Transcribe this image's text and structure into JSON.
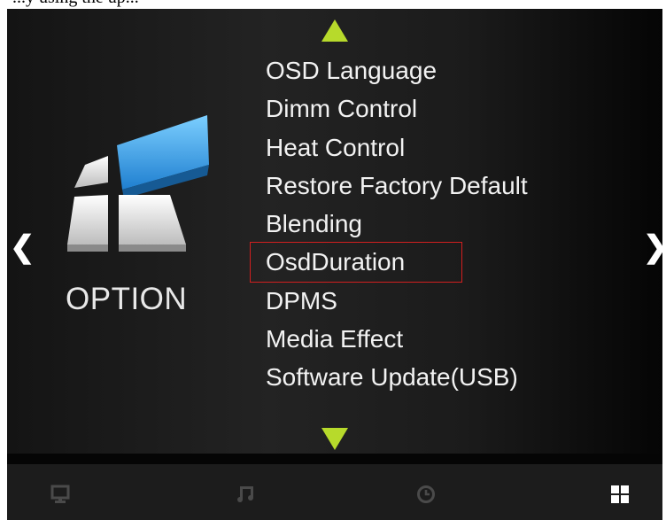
{
  "top_fragment": "...y using the up...",
  "navigation": {
    "left_chevron": "❮",
    "right_chevron": "❯"
  },
  "category": {
    "label": "OPTION",
    "icon": "option-tiles-icon"
  },
  "menu": {
    "items": [
      {
        "label": "OSD Language"
      },
      {
        "label": "Dimm Control"
      },
      {
        "label": "Heat Control"
      },
      {
        "label": "Restore Factory Default"
      },
      {
        "label": "Blending"
      },
      {
        "label": "OsdDuration",
        "selected": true
      },
      {
        "label": "DPMS"
      },
      {
        "label": "Media Effect"
      },
      {
        "label": "Software Update(USB)"
      }
    ]
  },
  "bottom_bar": {
    "icons": [
      "monitor-icon",
      "music-icon",
      "clock-icon",
      "grid-icon"
    ],
    "active": "grid-icon"
  },
  "colors": {
    "accent_arrow": "#b7da2b",
    "selection_border": "#d21f1f",
    "tile_blue": "#3aa0e6"
  }
}
